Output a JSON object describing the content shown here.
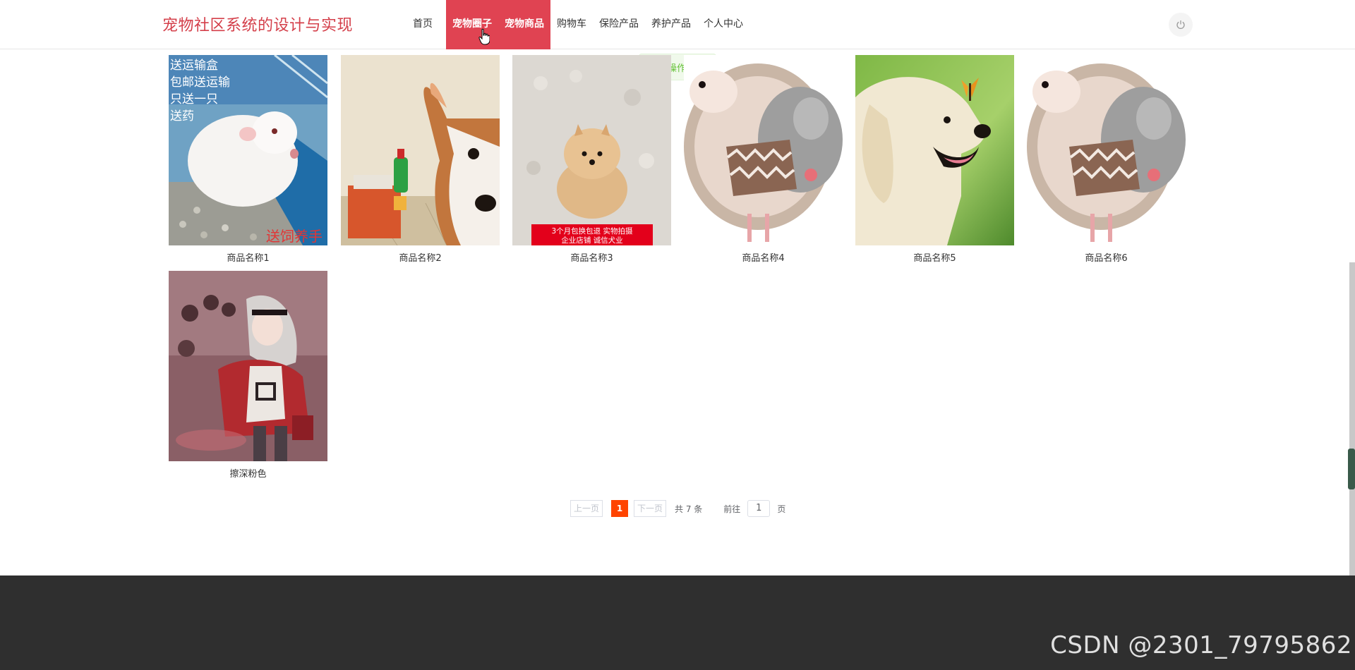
{
  "header": {
    "logo": "宠物社区系统的设计与实现",
    "nav": [
      {
        "label": "首页",
        "active": false
      },
      {
        "label": "宠物圈子",
        "active": true
      },
      {
        "label": "宠物商品",
        "active": true
      },
      {
        "label": "购物车",
        "active": false
      },
      {
        "label": "保险产品",
        "active": false
      },
      {
        "label": "养护产品",
        "active": false
      },
      {
        "label": "个人中心",
        "active": false
      }
    ],
    "power_icon": "power-icon"
  },
  "toast": {
    "text": "操作成功",
    "icon": "check-circle-icon",
    "color": "#67c23a"
  },
  "products": [
    {
      "name": "商品名称1",
      "overlay": "送运输盒\n包邮送运输\n只送一只\n送药",
      "badge": "送饲养手"
    },
    {
      "name": "商品名称2"
    },
    {
      "name": "商品名称3",
      "banner": "3个月包换包退 实物拍摄\n企业店铺 诚信犬业"
    },
    {
      "name": "商品名称4"
    },
    {
      "name": "商品名称5"
    },
    {
      "name": "商品名称6"
    },
    {
      "name": "擦深粉色"
    }
  ],
  "pagination": {
    "prev": "上一页",
    "current": "1",
    "next": "下一页",
    "total": "共 7 条",
    "goto": "前往",
    "page_input": "1",
    "unit": "页"
  },
  "watermark": "CSDN @2301_79795862",
  "colors": {
    "brand": "#d43f4a",
    "nav_active": "#e04352",
    "pager_active": "#ff4400",
    "footer": "#2f2f2f"
  }
}
